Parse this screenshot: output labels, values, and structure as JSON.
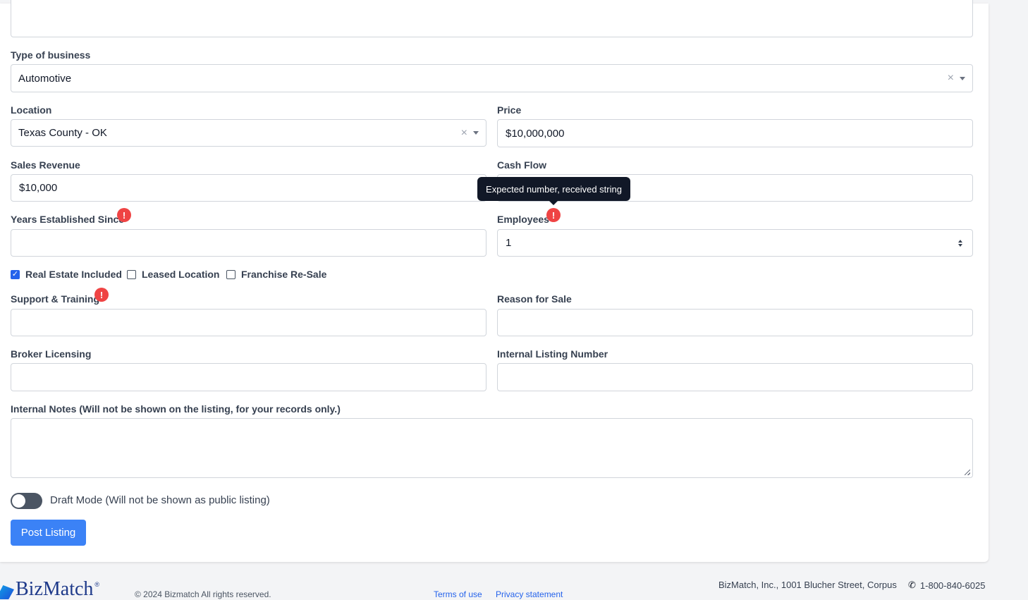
{
  "form": {
    "type_of_business": {
      "label": "Type of business",
      "value": "Automotive"
    },
    "location": {
      "label": "Location",
      "value": "Texas County - OK"
    },
    "price": {
      "label": "Price",
      "value": "$10,000,000"
    },
    "sales_revenue": {
      "label": "Sales Revenue",
      "value": "$10,000"
    },
    "cash_flow": {
      "label": "Cash Flow",
      "value": ""
    },
    "years_established": {
      "label": "Years Established Since",
      "value": ""
    },
    "employees": {
      "label": "Employees",
      "value": "1"
    },
    "checkboxes": [
      {
        "label": "Real Estate Included",
        "checked": true
      },
      {
        "label": "Leased Location",
        "checked": false
      },
      {
        "label": "Franchise Re-Sale",
        "checked": false
      }
    ],
    "support_training": {
      "label": "Support & Training",
      "value": ""
    },
    "reason_for_sale": {
      "label": "Reason for Sale",
      "value": ""
    },
    "broker_licensing": {
      "label": "Broker Licensing",
      "value": ""
    },
    "internal_listing_number": {
      "label": "Internal Listing Number",
      "value": ""
    },
    "internal_notes": {
      "label": "Internal Notes (Will not be shown on the listing, for your records only.)"
    },
    "draft_mode": {
      "label": "Draft Mode (Will not be shown as public listing)",
      "on": false
    },
    "submit_label": "Post Listing",
    "error_glyph": "!",
    "tooltip": "Expected number, received string"
  },
  "footer": {
    "brand": "BizMatch",
    "brand_mark": "®",
    "copyright": "© 2024 Bizmatch All rights reserved.",
    "links": [
      "Terms of use",
      "Privacy statement"
    ],
    "address": "BizMatch, Inc., 1001 Blucher Street, Corpus",
    "phone": "1-800-840-6025"
  },
  "colors": {
    "accent": "#3b82f6",
    "error": "#ef4444",
    "tooltip_bg": "#111827"
  }
}
